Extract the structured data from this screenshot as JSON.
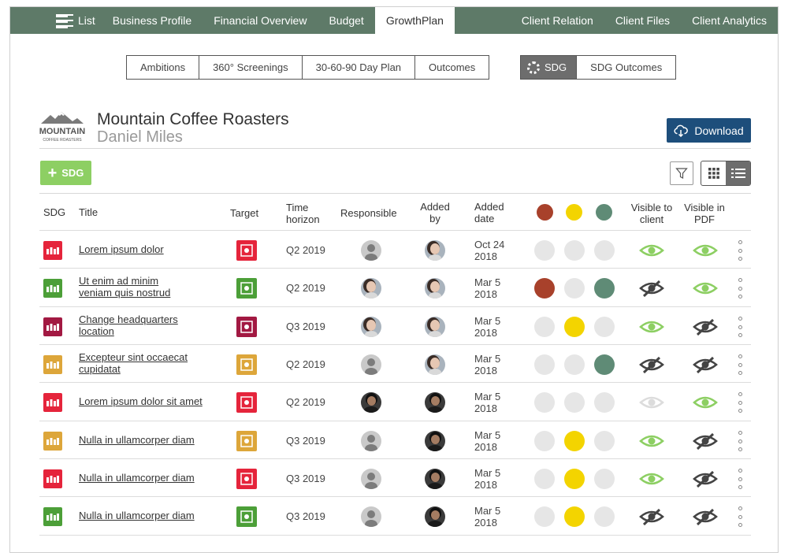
{
  "nav": {
    "list_label": "List",
    "items": [
      "Business Profile",
      "Financial Overview",
      "Budget",
      "GrowthPlan"
    ],
    "active": "GrowthPlan",
    "right_items": [
      "Client Relation",
      "Client Files",
      "Client Analytics"
    ]
  },
  "subtabs": [
    "Ambitions",
    "360° Screenings",
    "30-60-90 Day Plan",
    "Outcomes"
  ],
  "sdg_tabs": {
    "active": "SDG",
    "other": "SDG Outcomes"
  },
  "header": {
    "logo_text_top": "MOUNTAIN",
    "logo_text_bottom": "COFFEE ROASTERS",
    "company": "Mountain Coffee Roasters",
    "person": "Daniel Miles",
    "download_label": "Download"
  },
  "add_button_label": "SDG",
  "columns": {
    "sdg": "SDG",
    "title": "Title",
    "target": "Target",
    "time_horizon": [
      "Time",
      "horizon"
    ],
    "responsible": "Responsible",
    "added_by": [
      "Added",
      "by"
    ],
    "added_date": [
      "Added",
      "date"
    ],
    "visible_client": [
      "Visible to",
      "client"
    ],
    "visible_pdf": [
      "Visible in",
      "PDF"
    ]
  },
  "colors": {
    "nav_bg": "#5e7a68",
    "download_bg": "#1d4e7b",
    "add_bg": "#8dcf63",
    "status_red": "#a8412b",
    "status_yellow": "#f3d400",
    "status_green": "#5f8b76",
    "eye_on": "#8dcf63",
    "eye_off": "#444444"
  },
  "rows": [
    {
      "sdg_color": "#e5243b",
      "title": [
        "Lorem ipsum dolor"
      ],
      "target_color": "#e5243b",
      "horizon": "Q2 2019",
      "responsible": "gray",
      "added_by": "woman",
      "date": [
        "Oct 24",
        "2018"
      ],
      "status": [
        "none",
        "none",
        "none"
      ],
      "client": "on",
      "pdf": "on"
    },
    {
      "sdg_color": "#4c9f38",
      "title": [
        "Ut enim ad minim",
        "veniam quis nostrud"
      ],
      "target_color": "#4c9f38",
      "horizon": "Q2 2019",
      "responsible": "woman",
      "added_by": "woman",
      "date": [
        "Mar 5",
        "2018"
      ],
      "status": [
        "red",
        "none",
        "green"
      ],
      "client": "off",
      "pdf": "on"
    },
    {
      "sdg_color": "#a21942",
      "title": [
        "Change headquarters",
        "location"
      ],
      "target_color": "#a21942",
      "horizon": "Q3 2019",
      "responsible": "woman",
      "added_by": "woman",
      "date": [
        "Mar 5",
        "2018"
      ],
      "status": [
        "none",
        "yellow",
        "none"
      ],
      "client": "on",
      "pdf": "off"
    },
    {
      "sdg_color": "#dda63a",
      "title": [
        "Excepteur sint occaecat",
        "cupidatat"
      ],
      "target_color": "#dda63a",
      "horizon": "Q2 2019",
      "responsible": "gray",
      "added_by": "woman",
      "date": [
        "Mar 5",
        "2018"
      ],
      "status": [
        "none",
        "none",
        "green"
      ],
      "client": "off",
      "pdf": "off"
    },
    {
      "sdg_color": "#e5243b",
      "title": [
        "Lorem ipsum dolor sit amet"
      ],
      "target_color": "#e5243b",
      "horizon": "Q2 2019",
      "responsible": "man",
      "added_by": "man",
      "date": [
        "Mar 5",
        "2018"
      ],
      "status": [
        "none",
        "none",
        "none"
      ],
      "client": "faded",
      "pdf": "on"
    },
    {
      "sdg_color": "#dda63a",
      "title": [
        "Nulla in ullamcorper diam"
      ],
      "target_color": "#dda63a",
      "horizon": "Q3 2019",
      "responsible": "gray",
      "added_by": "man",
      "date": [
        "Mar 5",
        "2018"
      ],
      "status": [
        "none",
        "yellow",
        "none"
      ],
      "client": "on",
      "pdf": "off"
    },
    {
      "sdg_color": "#e5243b",
      "title": [
        "Nulla in ullamcorper diam"
      ],
      "target_color": "#e5243b",
      "horizon": "Q3 2019",
      "responsible": "gray",
      "added_by": "man",
      "date": [
        "Mar 5",
        "2018"
      ],
      "status": [
        "none",
        "yellow",
        "none"
      ],
      "client": "on",
      "pdf": "off"
    },
    {
      "sdg_color": "#4c9f38",
      "title": [
        "Nulla in ullamcorper diam"
      ],
      "target_color": "#4c9f38",
      "horizon": "Q3 2019",
      "responsible": "gray",
      "added_by": "man",
      "date": [
        "Mar 5",
        "2018"
      ],
      "status": [
        "none",
        "yellow",
        "none"
      ],
      "client": "off",
      "pdf": "off"
    }
  ]
}
